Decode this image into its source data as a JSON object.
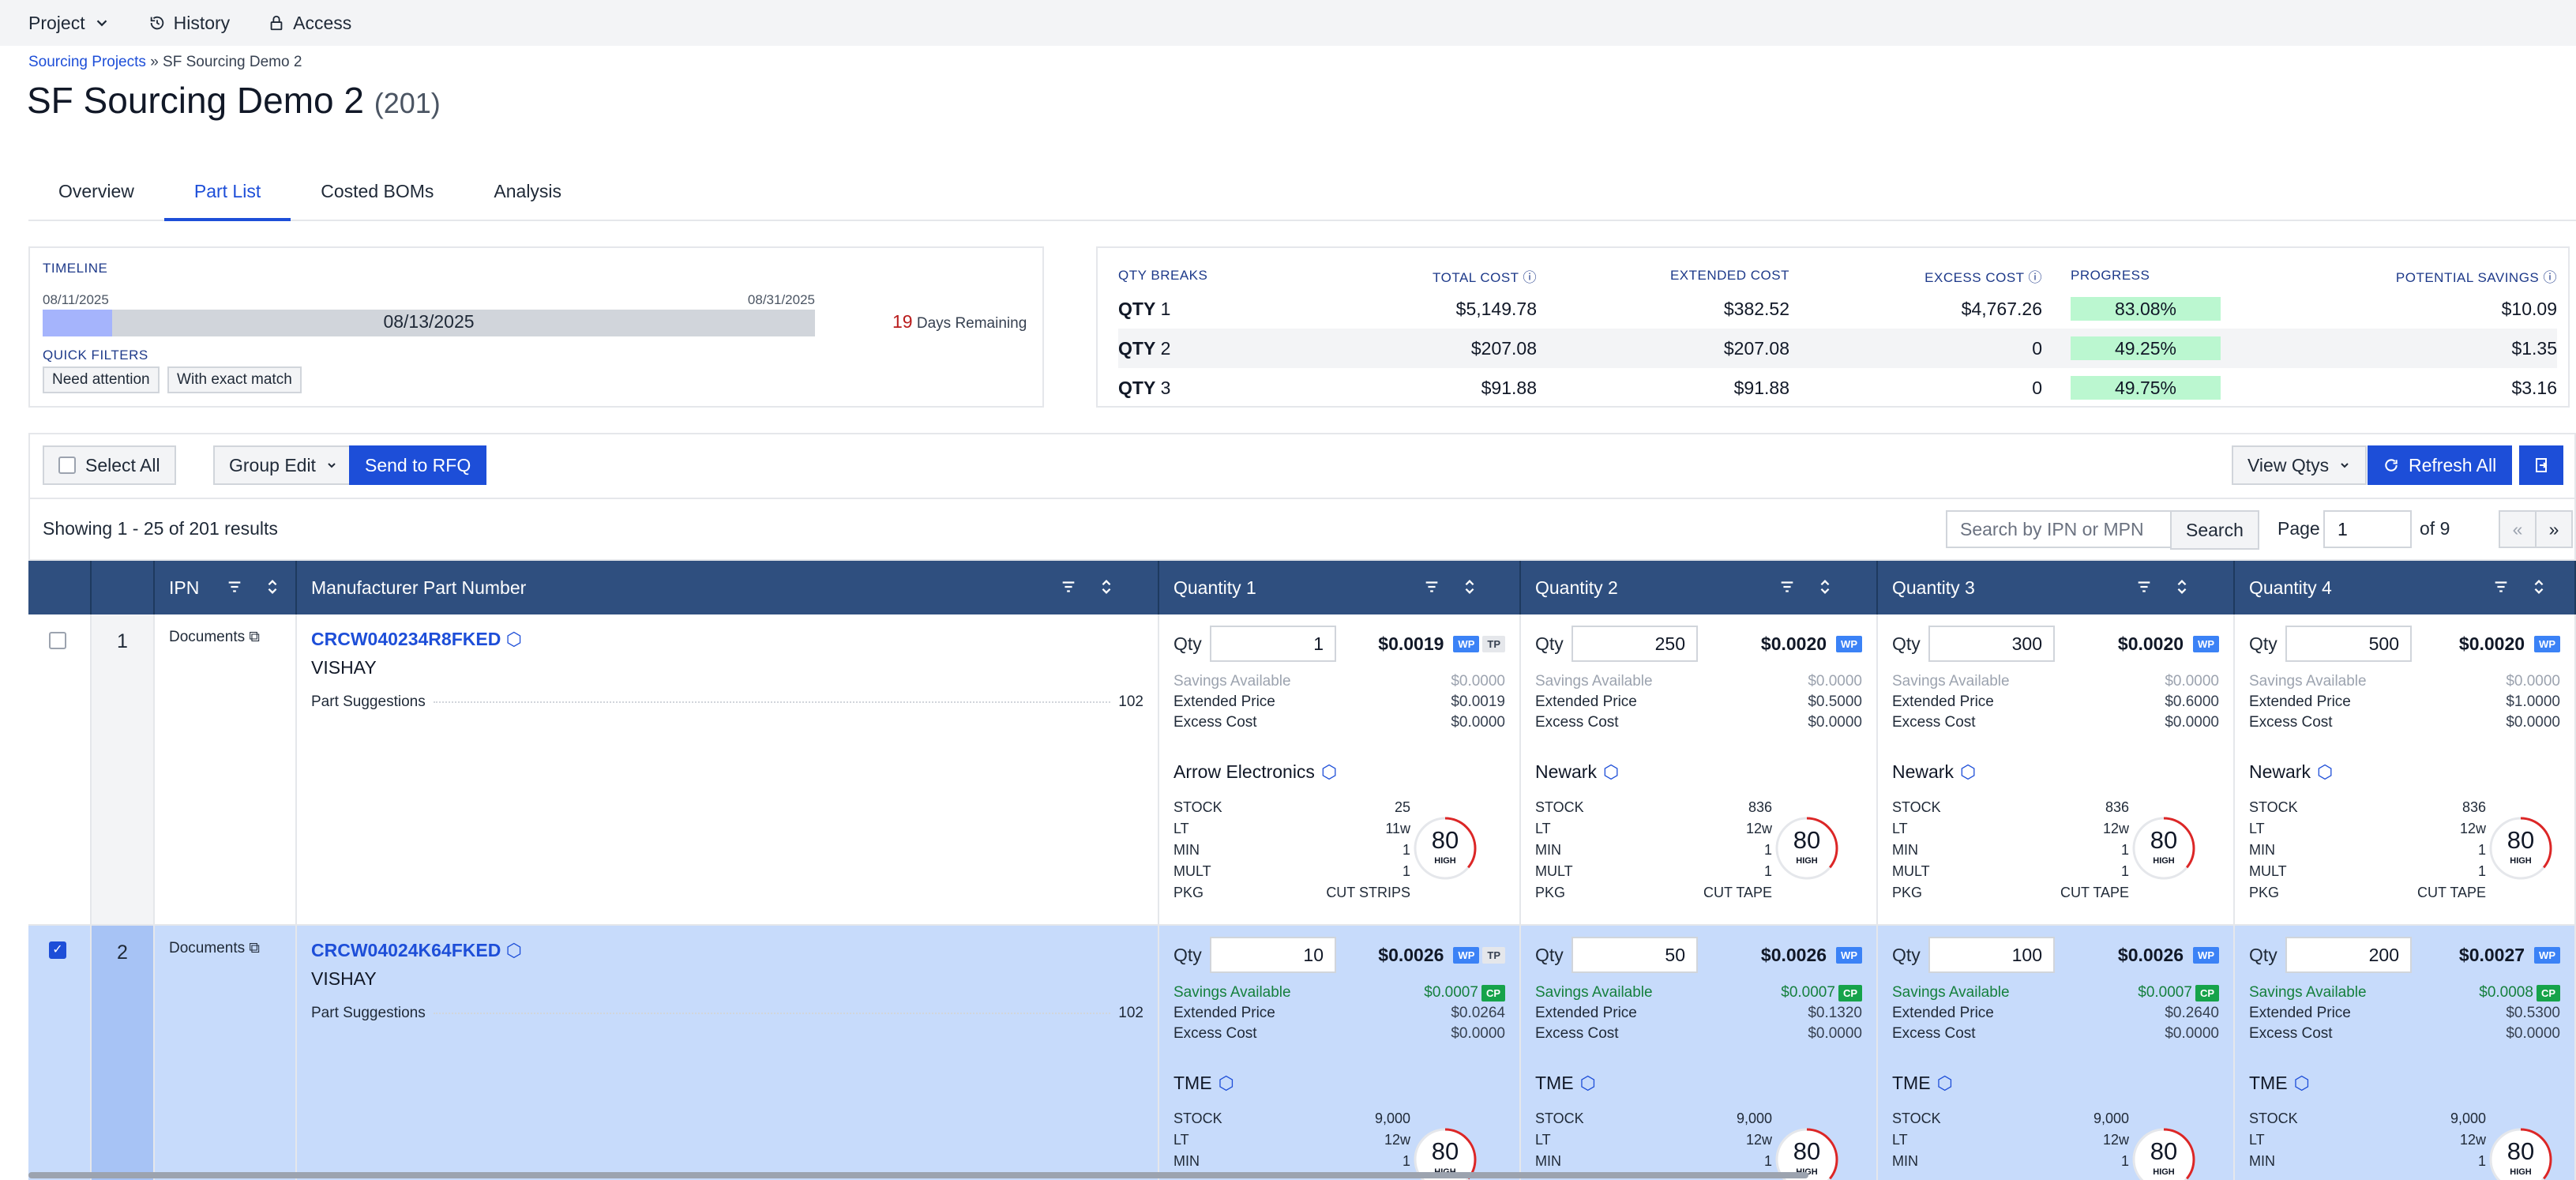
{
  "nav": {
    "project": "Project",
    "history": "History",
    "access": "Access"
  },
  "breadcrumb": {
    "root": "Sourcing Projects",
    "sep": "»",
    "current": "SF Sourcing Demo 2"
  },
  "page": {
    "title": "SF Sourcing Demo 2",
    "count": "(201)"
  },
  "tabs": [
    "Overview",
    "Part List",
    "Costed BOMs",
    "Analysis"
  ],
  "timeline": {
    "label": "TIMELINE",
    "start": "08/11/2025",
    "end": "08/31/2025",
    "current": "08/13/2025",
    "progress_fraction": 0.09,
    "days_remaining": "19",
    "days_label": "Days Remaining",
    "quick_filters_label": "QUICK FILTERS",
    "filters": [
      "Need attention",
      "With exact match"
    ]
  },
  "qty_breaks": {
    "headers": [
      "QTY BREAKS",
      "TOTAL COST",
      "EXTENDED COST",
      "EXCESS COST",
      "PROGRESS",
      "POTENTIAL SAVINGS"
    ],
    "rows": [
      {
        "label": "QTY",
        "n": "1",
        "total": "$5,149.78",
        "extended": "$382.52",
        "excess": "$4,767.26",
        "progress": "83.08%",
        "progress_value": 83.08,
        "savings": "$10.09"
      },
      {
        "label": "QTY",
        "n": "2",
        "total": "$207.08",
        "extended": "$207.08",
        "excess": "0",
        "progress": "49.25%",
        "progress_value": 49.25,
        "savings": "$1.35"
      },
      {
        "label": "QTY",
        "n": "3",
        "total": "$91.88",
        "extended": "$91.88",
        "excess": "0",
        "progress": "49.75%",
        "progress_value": 49.75,
        "savings": "$3.16"
      }
    ]
  },
  "toolbar": {
    "select_all": "Select All",
    "group_edit": "Group Edit",
    "send_rfq": "Send to RFQ",
    "view_qtys": "View Qtys",
    "refresh_all": "Refresh All"
  },
  "results": {
    "showing": "Showing 1 - 25 of 201 results",
    "search_placeholder": "Search by IPN or MPN",
    "search_button": "Search",
    "page_label": "Page",
    "page_value": "1",
    "of_label": "of 9",
    "prev": "«",
    "next": "»"
  },
  "grid": {
    "headers": {
      "ipn": "IPN",
      "mpn": "Manufacturer Part Number",
      "q1": "Quantity 1",
      "q2": "Quantity 2",
      "q3": "Quantity 3",
      "q4": "Quantity 4"
    },
    "labels": {
      "qty": "Qty",
      "savings": "Savings Available",
      "extended": "Extended Price",
      "excess": "Excess Cost",
      "stock": "STOCK",
      "lt": "LT",
      "min": "MIN",
      "mult": "MULT",
      "pkg": "PKG",
      "documents": "Documents",
      "suggestions": "Part Suggestions",
      "high": "HIGH"
    },
    "rows": [
      {
        "num": "1",
        "mpn": "CRCW040234R8FKED",
        "mfr": "VISHAY",
        "suggestions": "102",
        "quantities": [
          {
            "qty": "1",
            "price": "$0.0019",
            "badges": [
              "WP",
              "TP"
            ],
            "savings": "$0.0000",
            "extended": "$0.0019",
            "excess": "$0.0000",
            "distributor": "Arrow Electronics",
            "stock": "25",
            "lt": "11w",
            "min": "1",
            "mult": "1",
            "pkg": "CUT STRIPS",
            "score": "80"
          },
          {
            "qty": "250",
            "price": "$0.0020",
            "badges": [
              "WP"
            ],
            "savings": "$0.0000",
            "extended": "$0.5000",
            "excess": "$0.0000",
            "distributor": "Newark",
            "stock": "836",
            "lt": "12w",
            "min": "1",
            "mult": "1",
            "pkg": "CUT TAPE",
            "score": "80"
          },
          {
            "qty": "300",
            "price": "$0.0020",
            "badges": [
              "WP"
            ],
            "savings": "$0.0000",
            "extended": "$0.6000",
            "excess": "$0.0000",
            "distributor": "Newark",
            "stock": "836",
            "lt": "12w",
            "min": "1",
            "mult": "1",
            "pkg": "CUT TAPE",
            "score": "80"
          },
          {
            "qty": "500",
            "price": "$0.0020",
            "badges": [
              "WP"
            ],
            "savings": "$0.0000",
            "extended": "$1.0000",
            "excess": "$0.0000",
            "distributor": "Newark",
            "stock": "836",
            "lt": "12w",
            "min": "1",
            "mult": "1",
            "pkg": "CUT TAPE",
            "score": "80"
          }
        ]
      },
      {
        "num": "2",
        "mpn": "CRCW04024K64FKED",
        "mfr": "VISHAY",
        "suggestions": "102",
        "quantities": [
          {
            "qty": "10",
            "price": "$0.0026",
            "badges": [
              "WP",
              "TP"
            ],
            "savings": "$0.0007",
            "extended": "$0.0264",
            "excess": "$0.0000",
            "distributor": "TME",
            "stock": "9,000",
            "lt": "12w",
            "min": "1",
            "score": "80"
          },
          {
            "qty": "50",
            "price": "$0.0026",
            "badges": [
              "WP"
            ],
            "savings": "$0.0007",
            "extended": "$0.1320",
            "excess": "$0.0000",
            "distributor": "TME",
            "stock": "9,000",
            "lt": "12w",
            "min": "1",
            "score": "80"
          },
          {
            "qty": "100",
            "price": "$0.0026",
            "badges": [
              "WP"
            ],
            "savings": "$0.0007",
            "extended": "$0.2640",
            "excess": "$0.0000",
            "distributor": "TME",
            "stock": "9,000",
            "lt": "12w",
            "min": "1",
            "score": "80"
          },
          {
            "qty": "200",
            "price": "$0.0027",
            "badges": [
              "WP"
            ],
            "savings": "$0.0008",
            "extended": "$0.5300",
            "excess": "$0.0000",
            "distributor": "TME",
            "stock": "9,000",
            "lt": "12w",
            "min": "1",
            "score": "80"
          }
        ]
      }
    ]
  }
}
